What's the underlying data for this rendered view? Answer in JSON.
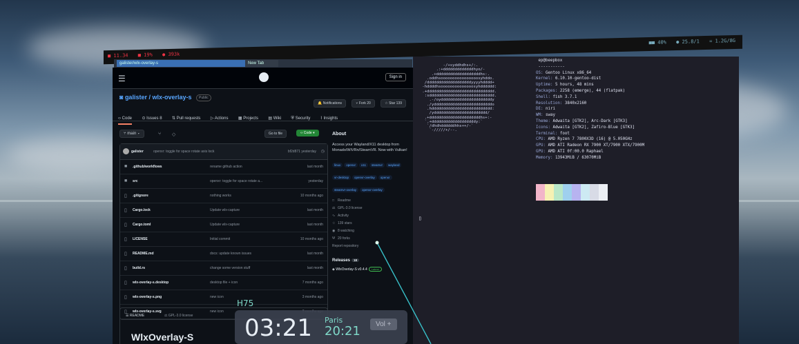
{
  "topbar": {
    "left_items": [
      "■ 11.34",
      "■ 19%",
      "● 393k"
    ],
    "right_items": [
      "■■ 40%",
      "● 25.8/1",
      "= 1.2G/8G"
    ]
  },
  "browser": {
    "tabs": [
      "galister/wlx-overlay-s",
      "New Tab"
    ]
  },
  "github": {
    "signin_label": "Sign in",
    "repo_owner": "galister",
    "repo_name": "wlx-overlay-s",
    "visibility": "Public",
    "notifications_label": "Notifications",
    "fork_label": "Fork",
    "fork_count": "20",
    "star_label": "Star",
    "star_count": "139",
    "nav_tabs": [
      "Code",
      "Issues",
      "Pull requests",
      "Actions",
      "Projects",
      "Wiki",
      "Security",
      "Insights"
    ],
    "issues_count": "8",
    "branch": "main",
    "go_to_file": "Go to file",
    "code_button": "Code",
    "last_commit": {
      "user": "galister",
      "message": "openxr: toggle for space rotate axis lock",
      "meta": "bf2d871 yesterday"
    },
    "files": [
      {
        "name": ".github/workflows",
        "msg": "rename github action",
        "date": "last month",
        "dir": true
      },
      {
        "name": "src",
        "msg": "openxr: toggle for space rotate a...",
        "date": "yesterday",
        "dir": true
      },
      {
        "name": ".gitignore",
        "msg": "nothing works",
        "date": "10 months ago",
        "dir": false
      },
      {
        "name": "Cargo.lock",
        "msg": "Update wlx-capture",
        "date": "last month",
        "dir": false
      },
      {
        "name": "Cargo.toml",
        "msg": "Update wlx-capture",
        "date": "last month",
        "dir": false
      },
      {
        "name": "LICENSE",
        "msg": "Initial commit",
        "date": "10 months ago",
        "dir": false
      },
      {
        "name": "README.md",
        "msg": "docs: update known issues",
        "date": "last month",
        "dir": false
      },
      {
        "name": "build.rs",
        "msg": "change some version stuff",
        "date": "last month",
        "dir": false
      },
      {
        "name": "wlx-overlay-s.desktop",
        "msg": "desktop file + icon",
        "date": "7 months ago",
        "dir": false
      },
      {
        "name": "wlx-overlay-s.png",
        "msg": "new icon",
        "date": "3 months ago",
        "dir": false
      },
      {
        "name": "wlx-overlay-s.svg",
        "msg": "new icon",
        "date": "3 months ago",
        "dir": false
      }
    ],
    "readme_tab": "README",
    "license_tab": "GPL-3.0 license",
    "readme_title": "WlxOverlay-S",
    "about": {
      "heading": "About",
      "description": "Access your Wayland/X11 desktop from Monado/WiVRn/SteamVR. Now with Vulkan!",
      "topics": [
        "linux",
        "openxr",
        "x11",
        "steamvr",
        "wayland",
        "vr-desktop",
        "openvr-overlay",
        "openxr",
        "steamvr-overlay",
        "openxr-overlay"
      ],
      "meta": [
        {
          "icon": "□",
          "label": "Readme"
        },
        {
          "icon": "⚖",
          "label": "GPL-3.0 license"
        },
        {
          "icon": "∿",
          "label": "Activity"
        },
        {
          "icon": "☆",
          "label": "139 stars"
        },
        {
          "icon": "◉",
          "label": "8 watching"
        },
        {
          "icon": "Ψ",
          "label": "20 forks"
        }
      ],
      "report": "Report repository",
      "releases_heading": "Releases",
      "releases_count": "18",
      "latest_release": "WlxOverlay-S v0.4.4",
      "latest_badge": "Latest"
    }
  },
  "terminal": {
    "ascii_art": "          -/+syddhdhs+/:.\n       .:+dddddddddddddhyo/-\n     .+dddddddddddddddddddhs:.\n   .oddhsoooooooooooooooosyhddo.\n  /dddddddddddddddddddyyyyhdddd+\n -hddddhsoooooooooooooosyhdddddd:\n .+ddddddddddddddddddddddddddddd.\n  :sdddddddddddddddddddddddddddd.\n    .-/oyddddddddddddddddddddddy\n   ./ydddddddddddddddddddddddddo\n   .hdddddddddddddddddddddddddd:\n    /yddddddddddddddddddddddd/\n  .+ddddddddddddddddddddddhs+:-\n  `.+dddddddddddddddddddy:`\n   `/dhdhddddddhhs++/-`\n    `-/////+/--.",
    "sysinfo": [
      {
        "k": "",
        "v": "ep@beepbox"
      },
      {
        "k": "",
        "v": "-----------"
      },
      {
        "k": "OS:",
        "v": "Gentoo Linux x86_64"
      },
      {
        "k": "Kernel:",
        "v": "6.10.10-gentoo-dist"
      },
      {
        "k": "Uptime:",
        "v": "5 hours, 48 mins"
      },
      {
        "k": "Packages:",
        "v": "2258 (emerge), 44 (flatpak)"
      },
      {
        "k": "Shell:",
        "v": "fish 3.7.1"
      },
      {
        "k": "Resolution:",
        "v": "3840x2160"
      },
      {
        "k": "DE:",
        "v": "niri"
      },
      {
        "k": "WM:",
        "v": "sway"
      },
      {
        "k": "Theme:",
        "v": "Adwaita [GTK2], Arc-Dark [GTK3]"
      },
      {
        "k": "Icons:",
        "v": "Adwaita [GTK2], Zafiro-Blue [GTK3]"
      },
      {
        "k": "Terminal:",
        "v": "foot"
      },
      {
        "k": "CPU:",
        "v": "AMD Ryzen 7 7800X3D (16) @ 5.050GHz"
      },
      {
        "k": "GPU:",
        "v": "AMD ATI Radeon RX 7900 XT/7900 XTX/7900M"
      },
      {
        "k": "GPU:",
        "v": "AMD ATI 0f:00.0 Raphael"
      },
      {
        "k": "Memory:",
        "v": "13943MiB / 63070MiB"
      }
    ],
    "palette": [
      "#f2b5c9",
      "#f6f1b3",
      "#b9e7c8",
      "#9fd0ee",
      "#b7b3f0",
      "#cdeaf3",
      "#d8dbe6",
      "#eceff4"
    ],
    "cursor": "▯"
  },
  "overlay": {
    "label": "H75",
    "time": "03:21",
    "city": "Paris",
    "city_time": "20:21",
    "vol_button": "Vol +"
  }
}
